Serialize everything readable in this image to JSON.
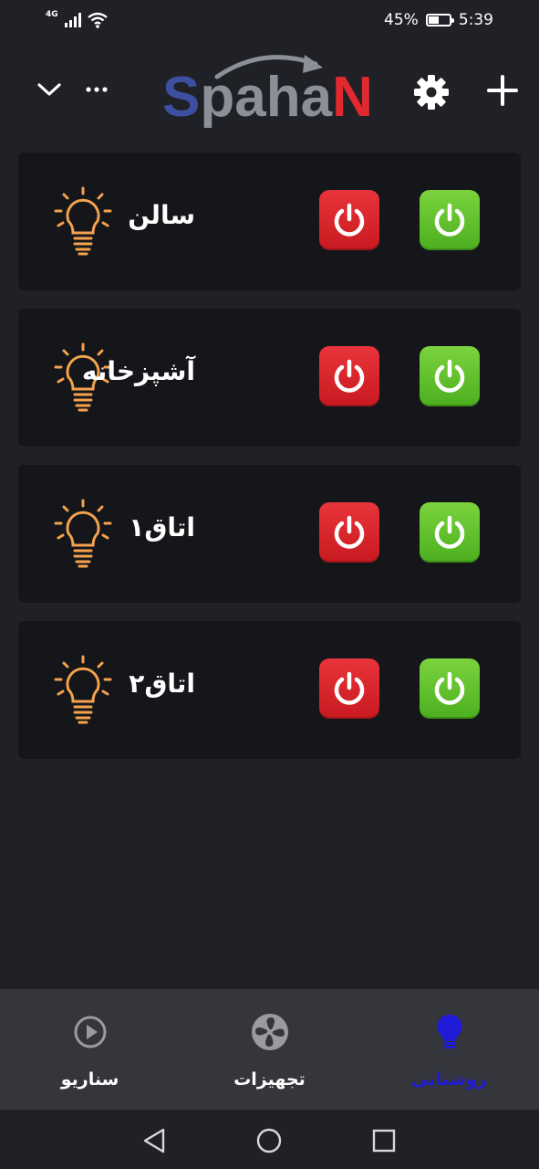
{
  "status_bar": {
    "network": "4G",
    "battery": "45%",
    "battery_level": 0.45,
    "time": "5:39"
  },
  "header": {
    "logo": "SpahaN",
    "icons": [
      "chevron-down-icon",
      "more-icon",
      "gear-icon",
      "plus-icon"
    ]
  },
  "rooms": [
    {
      "name": "سالن"
    },
    {
      "name": "آشپزخانه"
    },
    {
      "name": "اتاق۱"
    },
    {
      "name": "اتاق۲"
    }
  ],
  "bottom_nav": {
    "items": [
      {
        "label": "روشنایی",
        "icon": "bulb-icon",
        "active": true
      },
      {
        "label": "تجهیزات",
        "icon": "fan-icon",
        "active": false
      },
      {
        "label": "سناریو",
        "icon": "play-icon",
        "active": false
      }
    ]
  },
  "colors": {
    "background": "#1f2126",
    "card": "#15161a",
    "bulb": "#f4a24e",
    "off_button": "#e02a30",
    "on_button": "#5cc22c",
    "active_tab": "#1f1bd6",
    "nav_bar": "#35363b"
  }
}
